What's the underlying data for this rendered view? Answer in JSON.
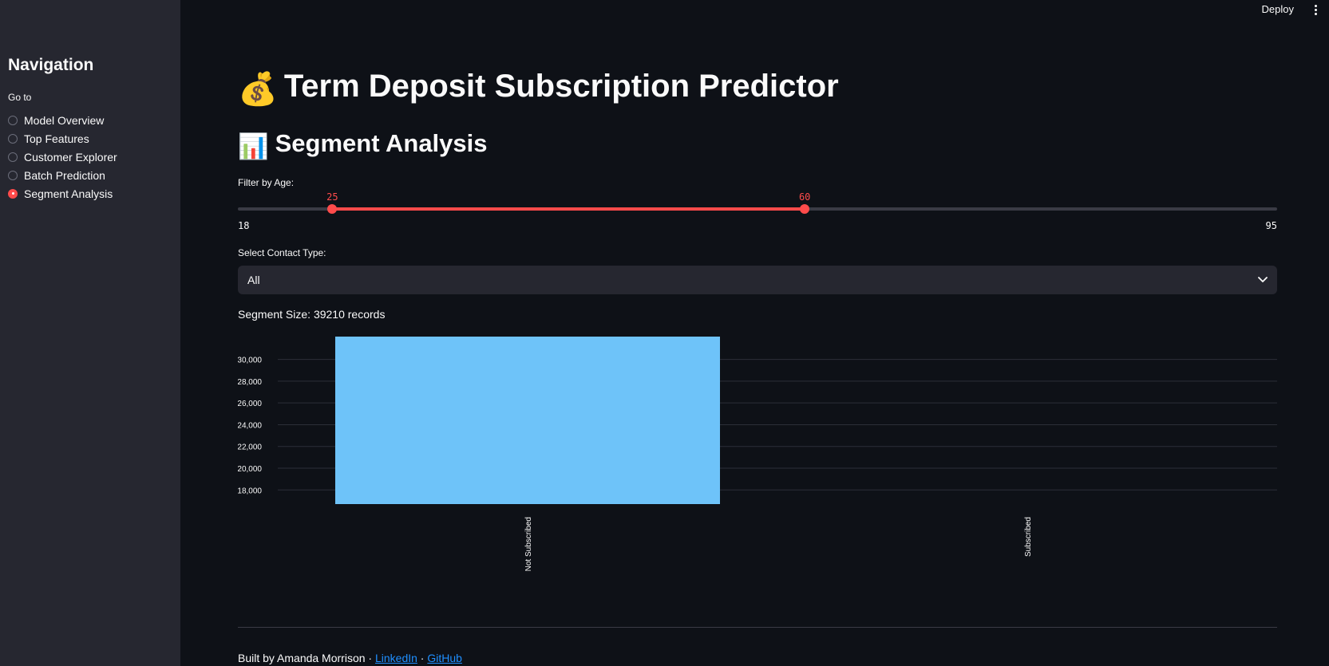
{
  "topbar": {
    "deploy_label": "Deploy",
    "menu_icon": "more-vertical-icon"
  },
  "sidebar": {
    "title": "Navigation",
    "goto_label": "Go to",
    "items": [
      {
        "label": "Model Overview",
        "selected": false
      },
      {
        "label": "Top Features",
        "selected": false
      },
      {
        "label": "Customer Explorer",
        "selected": false
      },
      {
        "label": "Batch Prediction",
        "selected": false
      },
      {
        "label": "Segment Analysis",
        "selected": true
      }
    ]
  },
  "main": {
    "title_emoji": "💰",
    "title": "Term Deposit Subscription Predictor",
    "section_emoji": "📊",
    "section_title": "Segment Analysis",
    "age_filter": {
      "label": "Filter by Age:",
      "min": 18,
      "max": 95,
      "low": 25,
      "high": 60
    },
    "contact_type": {
      "label": "Select Contact Type:",
      "value": "All"
    },
    "segment_size": "Segment Size: 39210 records"
  },
  "chart_data": {
    "type": "bar",
    "categories": [
      "Not Subscribed",
      "Subscribed"
    ],
    "values": [
      32100,
      0
    ],
    "ylim": [
      16700,
      32100
    ],
    "yticks": [
      18000,
      20000,
      22000,
      24000,
      26000,
      28000,
      30000
    ],
    "ytick_labels": [
      "18,000",
      "20,000",
      "22,000",
      "24,000",
      "26,000",
      "28,000",
      "30,000"
    ],
    "grid": true,
    "bar_color": "#6ec3f9"
  },
  "footer": {
    "text": "Built by Amanda Morrison · ",
    "separator": " · ",
    "linkedin": "LinkedIn",
    "github": "GitHub"
  },
  "colors": {
    "accent": "#ff4b4b",
    "background": "#0e1117",
    "sidebar": "#262730",
    "link": "#1f8fff"
  }
}
